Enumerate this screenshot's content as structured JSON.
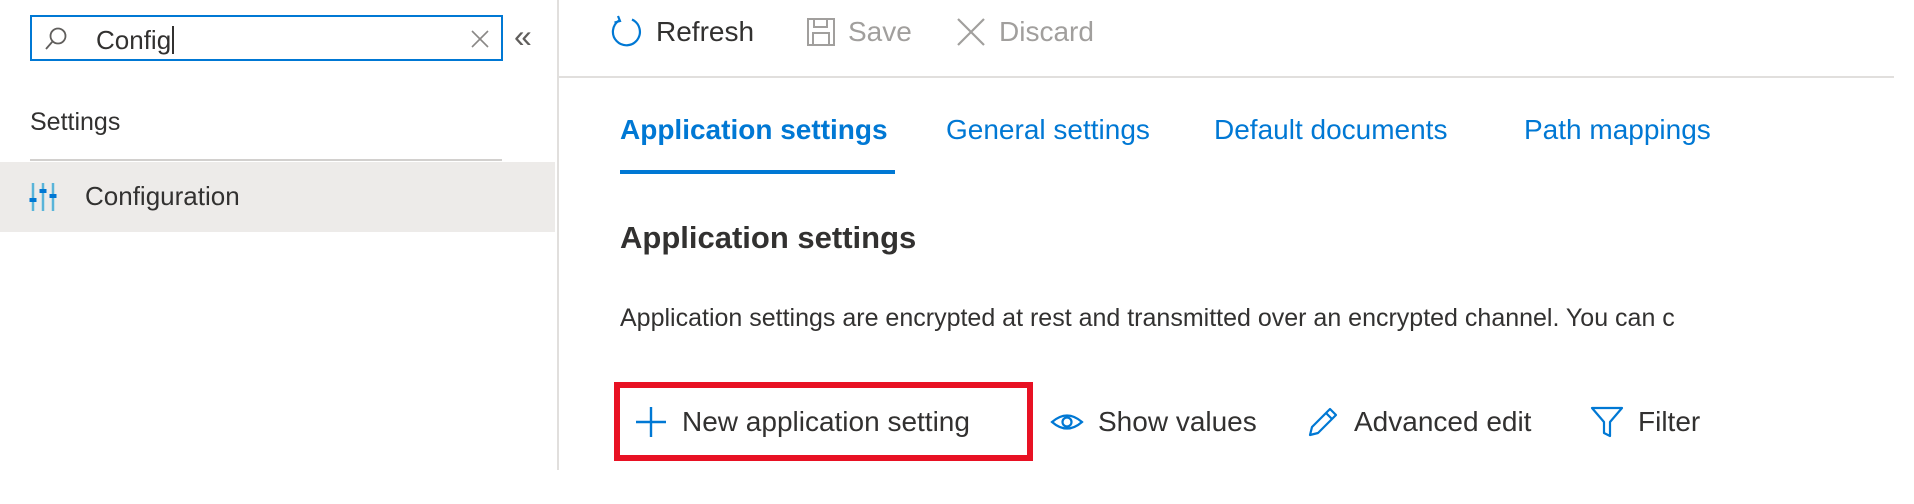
{
  "search": {
    "value": "Config",
    "placeholder": ""
  },
  "sidebar": {
    "section_title": "Settings",
    "items": [
      {
        "label": "Configuration",
        "icon": "sliders-icon",
        "selected": true
      }
    ]
  },
  "toolbar": {
    "refresh_label": "Refresh",
    "save_label": "Save",
    "discard_label": "Discard"
  },
  "tabs": [
    {
      "label": "Application settings",
      "active": true
    },
    {
      "label": "General settings",
      "active": false
    },
    {
      "label": "Default documents",
      "active": false
    },
    {
      "label": "Path mappings",
      "active": false
    }
  ],
  "main": {
    "heading": "Application settings",
    "description": "Application settings are encrypted at rest and transmitted over an encrypted channel. You can c"
  },
  "commands": {
    "new_label": "New application setting",
    "show_values_label": "Show values",
    "advanced_edit_label": "Advanced edit",
    "filter_label": "Filter"
  },
  "colors": {
    "accent": "#0078d4",
    "highlight": "#e81123",
    "selected_bg": "#edebe9",
    "disabled_text": "#a19f9d"
  }
}
